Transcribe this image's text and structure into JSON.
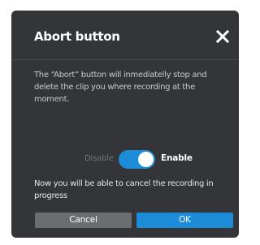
{
  "dialog": {
    "title": "Abort button",
    "close_icon": "close-icon",
    "description": "The “Abort” button will inmediatelly stop and delete the clip you where recording at the moment.",
    "toggle": {
      "off_label": "Disable",
      "on_label": "Enable",
      "state": "on"
    },
    "info": "Now you will be able to cancel the recording in progress",
    "buttons": {
      "cancel_label": "Cancel",
      "ok_label": "OK"
    }
  },
  "colors": {
    "dialog_bg": "#333538",
    "accent": "#1d8cd8",
    "cancel_bg": "#6b6d71",
    "muted_text": "#73767b"
  }
}
